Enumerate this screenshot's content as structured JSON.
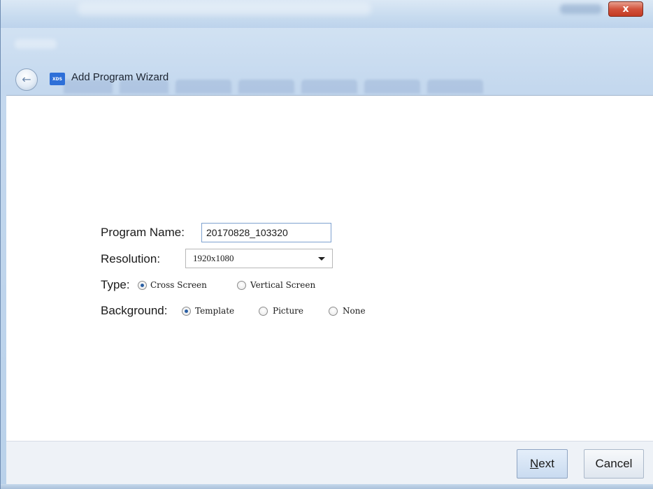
{
  "window": {
    "close_label": "x"
  },
  "header": {
    "back_icon": "back-arrow-icon",
    "app_icon_text": "XDS",
    "title": "Add Program Wizard"
  },
  "form": {
    "program_name_label": "Program Name:",
    "program_name_value": "20170828_103320",
    "resolution_label": "Resolution:",
    "resolution_value": "1920x1080",
    "type_label": "Type:",
    "type_options": [
      {
        "label": "Cross Screen",
        "checked": true
      },
      {
        "label": "Vertical Screen",
        "checked": false
      }
    ],
    "background_label": "Background:",
    "background_options": [
      {
        "label": "Template",
        "checked": true
      },
      {
        "label": "Picture",
        "checked": false
      },
      {
        "label": "None",
        "checked": false
      }
    ]
  },
  "footer": {
    "next_first": "N",
    "next_rest": "ext",
    "cancel_label": "Cancel"
  },
  "colors": {
    "accent": "#2a5fa3",
    "close_red": "#c33b23"
  }
}
